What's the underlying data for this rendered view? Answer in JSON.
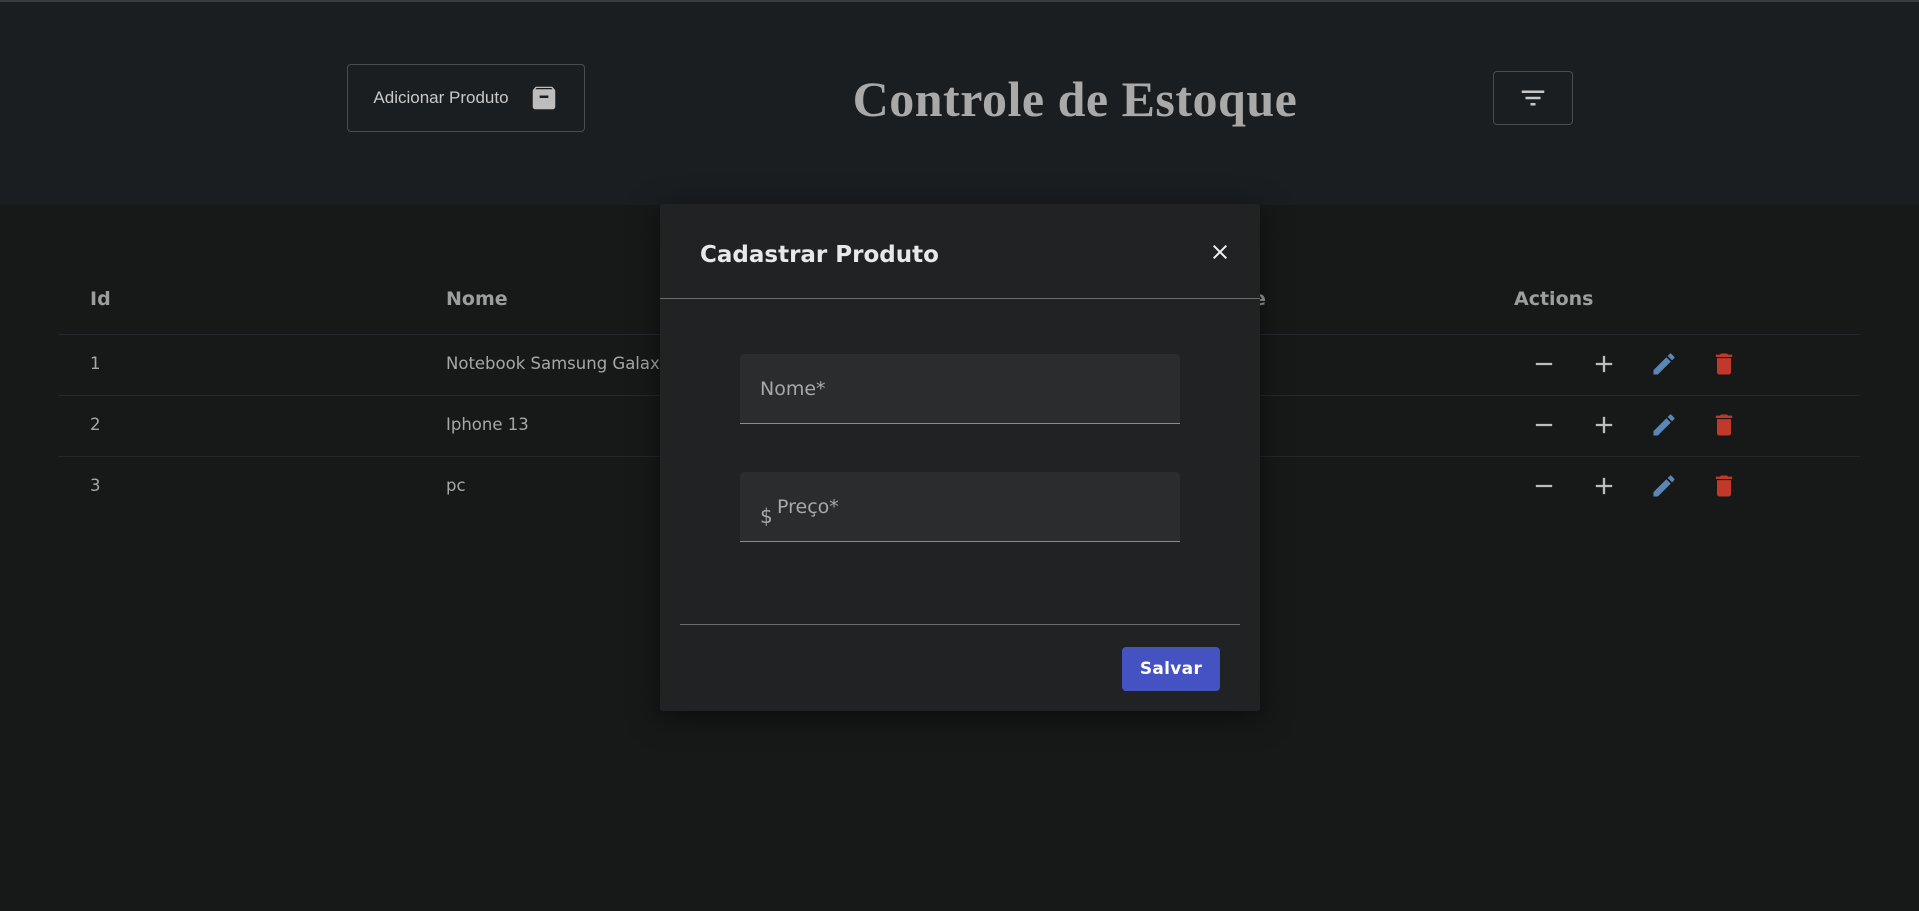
{
  "header": {
    "add_button_label": "Adicionar Produto",
    "title": "Controle de Estoque"
  },
  "table": {
    "columns": [
      "Id",
      "Nome",
      "e",
      "Actions"
    ],
    "rows": [
      {
        "id": "1",
        "nome": "Notebook Samsung Galaxy"
      },
      {
        "id": "2",
        "nome": "Iphone 13"
      },
      {
        "id": "3",
        "nome": "pc"
      }
    ]
  },
  "modal": {
    "title": "Cadastrar Produto",
    "fields": {
      "nome_label": "Nome*",
      "preco_prefix": "$",
      "preco_label": "Preço*"
    },
    "save_label": "Salvar"
  },
  "colors": {
    "accent": "#4553c2",
    "edit_icon": "#5b86b8",
    "delete_icon": "#c0392b"
  },
  "icons": {
    "add_button": "archive-icon",
    "filter_button": "filter-icon",
    "row_actions": [
      "minus-icon",
      "plus-icon",
      "edit-icon",
      "delete-icon"
    ],
    "modal_close": "close-icon"
  }
}
